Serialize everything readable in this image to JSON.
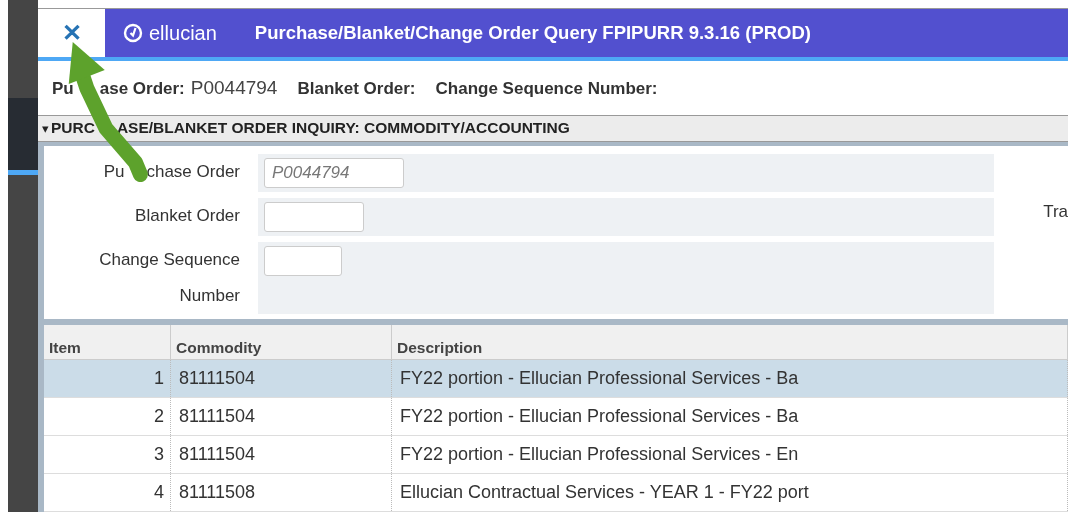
{
  "window": {
    "close": "✕",
    "brand": "ellucian",
    "title": "Purchase/Blanket/Change Order Query FPIPURR 9.3.16 (PROD)"
  },
  "key_block": [
    {
      "label_parts": [
        "Pu",
        "ase Order:"
      ],
      "value": "P0044794"
    },
    {
      "label_parts": [
        "Blanket Order:"
      ]
    },
    {
      "label_parts": [
        "Change Sequence Number:"
      ]
    }
  ],
  "section": {
    "caret": "▾",
    "title_parts": [
      "PURC",
      "ASE/BLANKET ORDER INQUIRY: COMMODITY/ACCOUNTING"
    ]
  },
  "form": [
    {
      "label_parts": [
        "Pu",
        "chase Order"
      ],
      "value": "P0044794"
    },
    {
      "label_parts": [
        "Blanket Order"
      ]
    },
    {
      "label_parts": [
        "Change Sequence Number"
      ]
    }
  ],
  "side_label": "Tra",
  "table": {
    "columns": [
      "Item",
      "Commodity",
      "Description"
    ],
    "rows": [
      {
        "item": "1",
        "commodity": "81111504",
        "description": "FY22 portion - Ellucian Professional Services - Ba",
        "selected": true
      },
      {
        "item": "2",
        "commodity": "81111504",
        "description": "FY22 portion - Ellucian Professional Services - Ba",
        "selected": false
      },
      {
        "item": "3",
        "commodity": "81111504",
        "description": "FY22 portion - Ellucian Professional Services - En",
        "selected": false
      },
      {
        "item": "4",
        "commodity": "81111508",
        "description": "Ellucian Contractual Services - YEAR 1 - FY22 port",
        "selected": false
      }
    ]
  }
}
